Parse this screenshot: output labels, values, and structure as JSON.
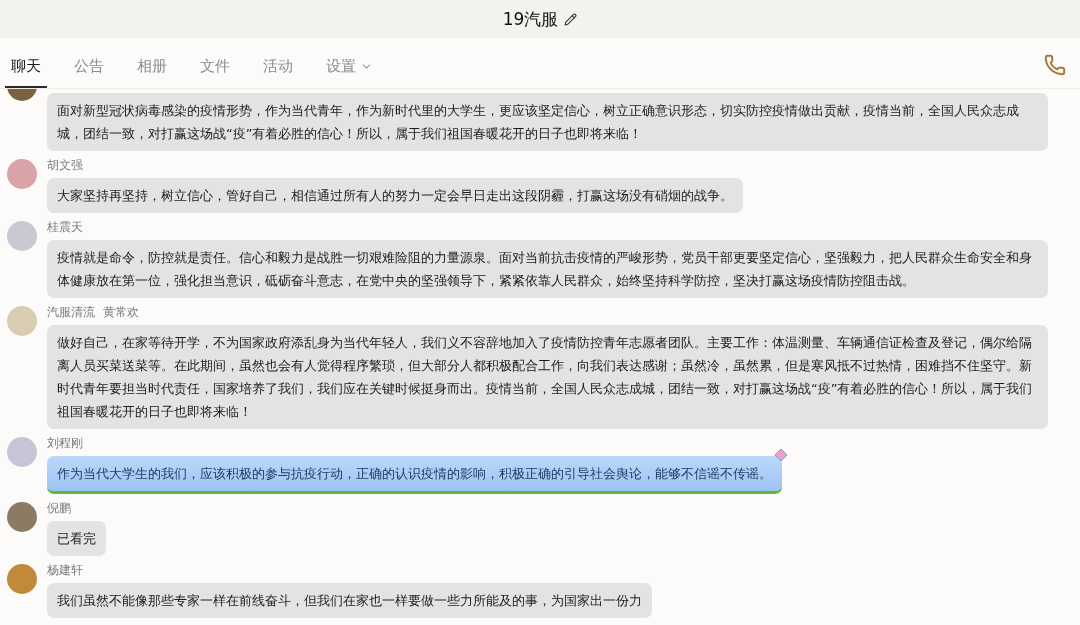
{
  "window": {
    "title": "19汽服"
  },
  "tabs": [
    {
      "label": "聊天",
      "selected": true,
      "kind": "tab"
    },
    {
      "label": "公告",
      "selected": false,
      "kind": "tab"
    },
    {
      "label": "相册",
      "selected": false,
      "kind": "tab"
    },
    {
      "label": "文件",
      "selected": false,
      "kind": "tab"
    },
    {
      "label": "活动",
      "selected": false,
      "kind": "tab"
    },
    {
      "label": "设置",
      "selected": false,
      "kind": "menu"
    }
  ],
  "messages": [
    {
      "kind": "plain",
      "text": "面对新型冠状病毒感染的疫情形势，作为当代青年，作为新时代里的大学生，更应该坚定信心，树立正确意识形态，切实防控疫情做出贡献，疫情当前，全国人民众志成城，团结一致，对打赢这场战“疫”有着必胜的信心！所以，属于我们祖国春暖花开的日子也即将来临！"
    },
    {
      "kind": "plain",
      "sender": "胡文强",
      "text": "大家坚持再坚持，树立信心，管好自己，相信通过所有人的努力一定会早日走出这段阴霾，打赢这场没有硝烟的战争。"
    },
    {
      "kind": "plain",
      "sender": "桂震天",
      "text": "疫情就是命令，防控就是责任。信心和毅力是战胜一切艰难险阻的力量源泉。面对当前抗击疫情的严峻形势，党员干部更要坚定信心，坚强毅力，把人民群众生命安全和身体健康放在第一位，强化担当意识，砥砺奋斗意志，在党中央的坚强领导下，紧紧依靠人民群众，始终坚持科学防控，坚决打赢这场疫情防控阻击战。"
    },
    {
      "kind": "plain",
      "tag": "汽服清流",
      "sender": "黄常欢",
      "text": "做好自己，在家等待开学，不为国家政府添乱身为当代年轻人，我们义不容辞地加入了疫情防控青年志愿者团队。主要工作：体温测量、车辆通信证检查及登记，偶尔给隔离人员买菜送菜等。在此期间，虽然也会有人觉得程序繁琐，但大部分人都积极配合工作，向我们表达感谢；虽然冷，虽然累，但是寒风抵不过热情，困难挡不住坚守。新时代青年要担当时代责任，国家培养了我们，我们应在关键时候挺身而出。疫情当前，全国人民众志成城，团结一致，对打赢这场战“疫”有着必胜的信心！所以，属于我们祖国春暖花开的日子也即将来临！"
    },
    {
      "kind": "themed",
      "sender": "刘程刚",
      "text": "作为当代大学生的我们，应该积极的参与抗疫行动，正确的认识疫情的影响，积极正确的引导社会舆论，能够不信谣不传谣。"
    },
    {
      "kind": "plain",
      "sender": "倪鹏",
      "text": "已看完"
    },
    {
      "kind": "plain",
      "sender": "杨建轩",
      "text": "我们虽然不能像那些专家一样在前线奋斗，但我们在家也一样要做一些力所能及的事，为国家出一份力"
    }
  ]
}
